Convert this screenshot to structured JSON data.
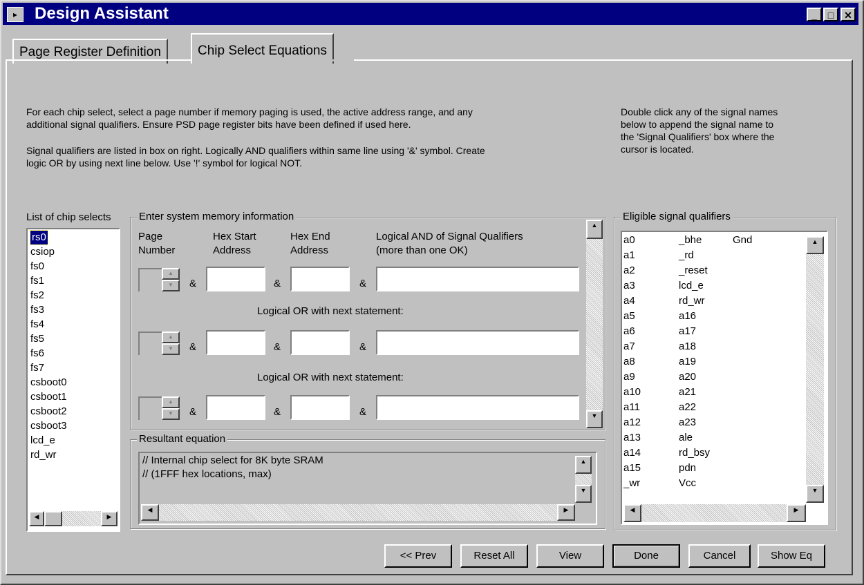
{
  "window": {
    "title": "Design Assistant"
  },
  "tabs": [
    "Page Register Definition",
    "Chip Select Equations"
  ],
  "instructions": {
    "para1_line1": "For each chip select, select a page number if memory paging is used, the active address range, and any",
    "para1_line2": "additional signal qualifiers. Ensure PSD page register bits have been defined if used here.",
    "para2_line1": "Signal qualifiers are listed in box on right. Logically AND qualifiers within same line using '&' symbol. Create",
    "para2_line2": "logic OR by using next line below. Use '!' symbol for logical NOT.",
    "right_line1": "Double click any of the signal names",
    "right_line2": "below to append the signal name to",
    "right_line3": "the 'Signal Qualifiers' box where the",
    "right_line4": "cursor is located."
  },
  "chip_selects": {
    "label": "List of chip selects",
    "items": [
      "rs0",
      "csiop",
      "fs0",
      "fs1",
      "fs2",
      "fs3",
      "fs4",
      "fs5",
      "fs6",
      "fs7",
      "csboot0",
      "csboot1",
      "csboot2",
      "csboot3",
      "lcd_e",
      "rd_wr"
    ],
    "selected": "rs0"
  },
  "memory": {
    "label": "Enter system memory information",
    "col_page_1": "Page",
    "col_page_2": "Number",
    "col_start_1": "Hex Start",
    "col_start_2": "Address",
    "col_end_1": "Hex End",
    "col_end_2": "Address",
    "col_qual_1": "Logical AND of Signal Qualifiers",
    "col_qual_2": "(more than one OK)",
    "amp": "&",
    "or_text": "Logical OR with next statement:"
  },
  "equation": {
    "label": "Resultant equation",
    "line1": "// Internal chip select for 8K byte SRAM",
    "line2": "// (1FFF hex locations, max)"
  },
  "qualifiers": {
    "label": "Eligible signal qualifiers",
    "col1": [
      "a0",
      "a1",
      "a2",
      "a3",
      "a4",
      "a5",
      "a6",
      "a7",
      "a8",
      "a9",
      "a10",
      "a11",
      "a12",
      "a13",
      "a14",
      "a15",
      "_wr"
    ],
    "col2": [
      "_bhe",
      "_rd",
      "_reset",
      "lcd_e",
      "rd_wr",
      "a16",
      "a17",
      "a18",
      "a19",
      "a20",
      "a21",
      "a22",
      "a23",
      "ale",
      "rd_bsy",
      "pdn",
      "Vcc"
    ],
    "col3": [
      "Gnd"
    ]
  },
  "buttons": {
    "prev": "<< Prev",
    "reset": "Reset All",
    "view": "View",
    "done": "Done",
    "cancel": "Cancel",
    "show_eq": "Show Eq"
  },
  "icons": {
    "minimize": "_",
    "maximize": "□",
    "close": "✕",
    "up": "▲",
    "down": "▼",
    "left": "◀",
    "right": "▶"
  }
}
